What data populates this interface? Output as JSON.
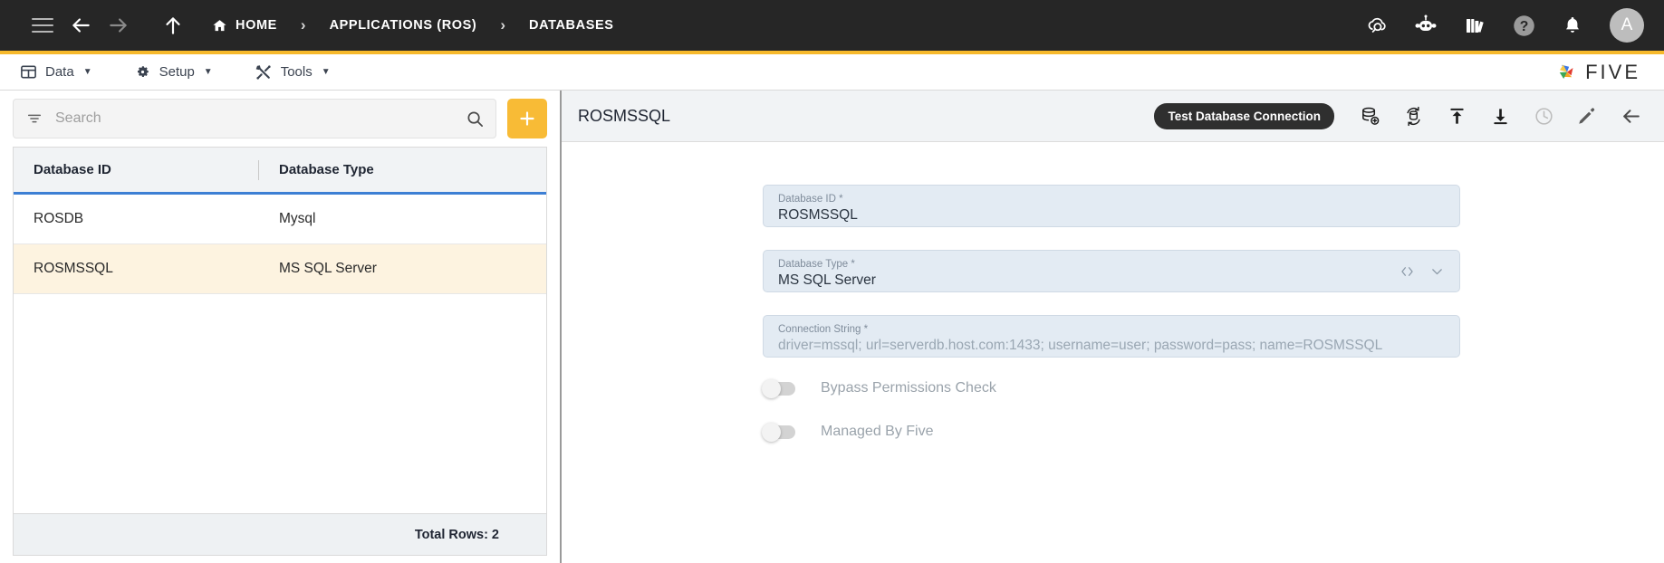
{
  "topbar": {
    "menu_icon": "hamburger-icon",
    "back_icon": "arrow-left-icon",
    "forward_icon": "arrow-right-icon",
    "up_icon": "arrow-up-icon",
    "breadcrumbs": [
      {
        "label": "HOME",
        "icon": "home-icon"
      },
      {
        "label": "APPLICATIONS (ROS)",
        "icon": ""
      },
      {
        "label": "DATABASES",
        "icon": ""
      }
    ],
    "separator": "›",
    "right_icons": [
      "cloud-search-icon",
      "robot-icon",
      "books-icon",
      "help-circle-icon",
      "bell-icon"
    ],
    "avatar_initial": "A",
    "accent_color": "#f6b92c"
  },
  "menubar": {
    "items": [
      {
        "label": "Data",
        "icon": "grid-table-icon",
        "caret": "▼"
      },
      {
        "label": "Setup",
        "icon": "gear-icon",
        "caret": "▼"
      },
      {
        "label": "Tools",
        "icon": "tools-icon",
        "caret": "▼"
      }
    ],
    "logo_text": "FIVE",
    "logo_icon": "five-pinwheel-icon"
  },
  "left_panel": {
    "search": {
      "placeholder": "Search",
      "value": "",
      "filter_icon": "filter-icon",
      "search_icon": "magnifier-icon"
    },
    "add_button": {
      "label": "+",
      "icon": "plus-icon"
    },
    "columns": [
      "Database ID",
      "Database Type"
    ],
    "rows": [
      {
        "id": "ROSDB",
        "type": "Mysql",
        "selected": false
      },
      {
        "id": "ROSMSSQL",
        "type": "MS SQL Server",
        "selected": true
      }
    ],
    "footer": "Total Rows: 2"
  },
  "detail": {
    "title": "ROSMSSQL",
    "test_button": "Test Database Connection",
    "action_icons": [
      "database-add-icon",
      "database-sync-icon",
      "upload-icon",
      "download-icon",
      "history-clock-icon",
      "edit-pencil-icon",
      "back-arrow-icon"
    ],
    "fields": [
      {
        "label": "Database ID *",
        "value": "ROSMSSQL",
        "muted": false,
        "adornments": []
      },
      {
        "label": "Database Type *",
        "value": "MS SQL Server",
        "muted": false,
        "adornments": [
          "code-brackets-icon",
          "chevron-down-icon"
        ]
      },
      {
        "label": "Connection String *",
        "value": "driver=mssql; url=serverdb.host.com:1433; username=user; password=pass; name=ROSMSSQL",
        "muted": true,
        "adornments": []
      }
    ],
    "toggles": [
      {
        "label": "Bypass Permissions Check",
        "on": false
      },
      {
        "label": "Managed By Five",
        "on": false
      }
    ]
  },
  "annotation": {
    "arrow_color": "#e8202a",
    "points_at": "edit-pencil-icon"
  },
  "colors": {
    "topbar_bg": "#262626",
    "accent": "#f6b92c",
    "selected_row": "#fdf3e0",
    "grid_header_underline": "#3d7fd4",
    "field_bg": "#e3ebf3"
  }
}
